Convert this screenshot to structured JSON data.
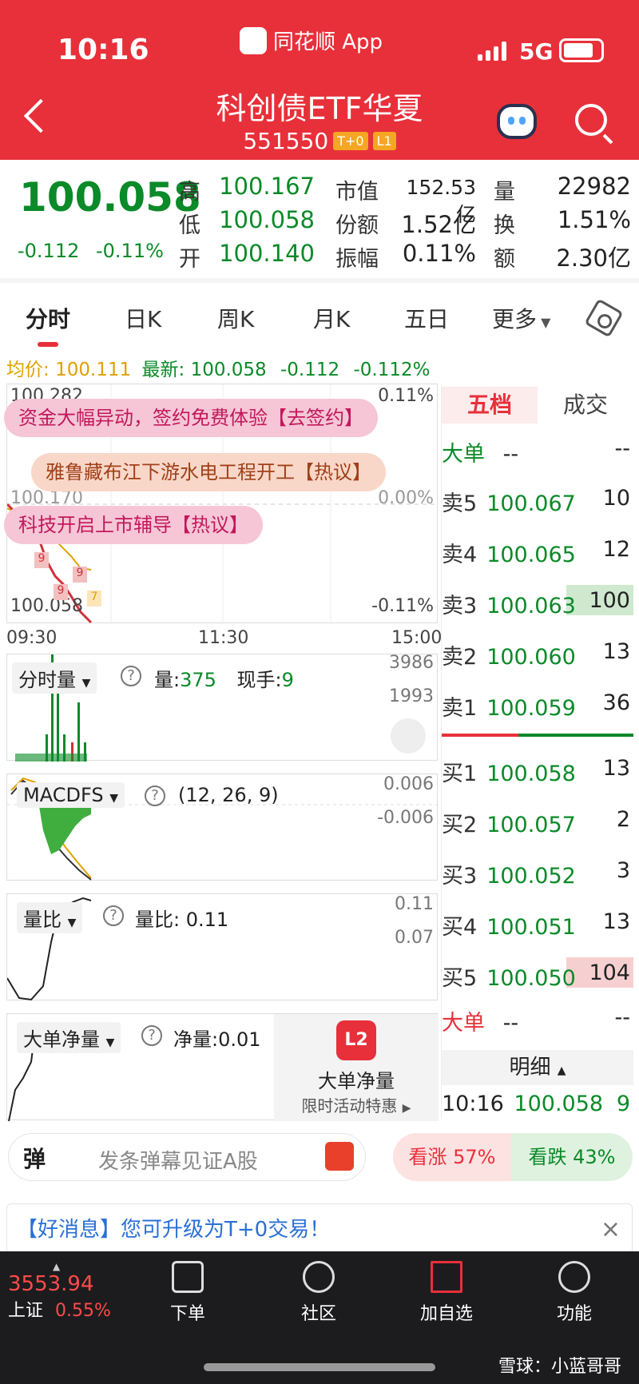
{
  "status": {
    "time": "10:16",
    "app": "同花顺 App",
    "network": "5G"
  },
  "header": {
    "title": "科创债ETF华夏",
    "code": "551550",
    "tag1": "T+0",
    "tag2": "L1"
  },
  "quote": {
    "price": "100.058",
    "change": "-0.112",
    "change_pct": "-0.11%",
    "high_label": "高",
    "high": "100.167",
    "low_label": "低",
    "low": "100.058",
    "open_label": "开",
    "open": "100.140",
    "mktcap_label": "市值",
    "mktcap": "152.53亿",
    "shares_label": "份额",
    "shares": "1.52亿",
    "amp_label": "振幅",
    "amp": "0.11%",
    "vol_label": "量",
    "vol": "22982",
    "turn_label": "换",
    "turn": "1.51%",
    "amt_label": "额",
    "amt": "2.30亿"
  },
  "tabs": [
    "分时",
    "日K",
    "周K",
    "月K",
    "五日",
    "更多"
  ],
  "avgline": {
    "avg_label": "均价:",
    "avg": "100.111",
    "last_label": "最新:",
    "last": "100.058",
    "chg": "-0.112",
    "pct": "-0.112%"
  },
  "chart": {
    "top_price": "100.282",
    "top_pct": "0.11%",
    "mid_price": "100.170",
    "mid_pct": "0.00%",
    "low_price": "100.058",
    "low_pct": "-0.11%",
    "time_start": "09:30",
    "time_mid": "11:30",
    "time_end": "15:00",
    "banner1": "资金大幅异动，签约免费体验【去签约】",
    "banner2": "雅鲁藏布江下游水电工程开工【热议】",
    "banner3": "科技开启上市辅导【热议】",
    "markers": [
      "9",
      "9",
      "9",
      "7"
    ]
  },
  "volume": {
    "selector": "分时量",
    "vol_label": "量:",
    "vol": "375",
    "hand_label": "现手:",
    "hand": "9",
    "max": "3986",
    "mid": "1993"
  },
  "macd": {
    "selector": "MACDFS",
    "params": "(12, 26, 9)",
    "top": "0.006",
    "bot": "-0.006"
  },
  "ratio": {
    "selector": "量比",
    "label": "量比: 0.11",
    "top": "0.11",
    "mid": "0.07"
  },
  "bignet": {
    "selector": "大单净量",
    "label": "净量:0.01",
    "promo_title": "大单净量",
    "promo_sub": "限时活动特惠",
    "promo_icon": "L2"
  },
  "orderbook": {
    "tab_active": "五档",
    "tab_other": "成交",
    "big_label": "大单",
    "big_dash1": "--",
    "big_dash2": "--",
    "sells": [
      {
        "label": "卖5",
        "price": "100.067",
        "vol": "10"
      },
      {
        "label": "卖4",
        "price": "100.065",
        "vol": "12"
      },
      {
        "label": "卖3",
        "price": "100.063",
        "vol": "100"
      },
      {
        "label": "卖2",
        "price": "100.060",
        "vol": "13"
      },
      {
        "label": "卖1",
        "price": "100.059",
        "vol": "36"
      }
    ],
    "buys": [
      {
        "label": "买1",
        "price": "100.058",
        "vol": "13"
      },
      {
        "label": "买2",
        "price": "100.057",
        "vol": "2"
      },
      {
        "label": "买3",
        "price": "100.052",
        "vol": "3"
      },
      {
        "label": "买4",
        "price": "100.051",
        "vol": "13"
      },
      {
        "label": "买5",
        "price": "100.050",
        "vol": "104"
      }
    ],
    "big2_label": "大单",
    "big2_dash1": "--",
    "big2_dash2": "--",
    "detail_label": "明细",
    "detail_time": "10:16",
    "detail_price": "100.058",
    "detail_vol": "9"
  },
  "danmu": {
    "icon": "弹",
    "placeholder": "发条弹幕见证A股",
    "up": "看涨 57%",
    "down": "看跌 43%"
  },
  "notice": {
    "prefix": "【好消息】",
    "text": "您可升级为T+0交易！"
  },
  "index": {
    "value": "3553.94",
    "name": "上证",
    "pct": "0.55%"
  },
  "nav": [
    "下单",
    "社区",
    "加自选",
    "功能"
  ],
  "watermark": "雪球：小蓝哥哥"
}
